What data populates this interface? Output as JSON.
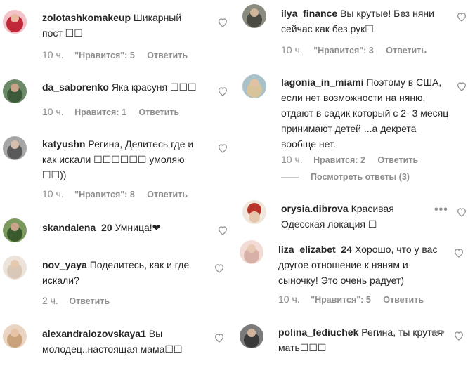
{
  "left": [
    {
      "username": "zolotashkomakeup",
      "text": "Шикарный пост ☐☐",
      "time": "10 ч.",
      "likes": "\"Нравится\": 5",
      "reply": "Ответить",
      "avatar_color": "#c0283a"
    },
    {
      "username": "da_saborenko",
      "text": "Яка красуня ☐☐☐",
      "time": "10 ч.",
      "likes": "Нравится: 1",
      "reply": "Ответить",
      "avatar_color": "#3d5a3a"
    },
    {
      "username": "katyushn",
      "text": "Регина, Делитесь где и как искали ☐☐☐☐☐☐ умоляю ☐☐))",
      "time": "10 ч.",
      "likes": "\"Нравится\": 8",
      "reply": "Ответить",
      "avatar_color": "#5a5a5a"
    },
    {
      "username": "skandalena_20",
      "text": "Умница!❤",
      "avatar_color": "#3b5b2f"
    },
    {
      "username": "nov_yaya",
      "text": "Поделитесь, как и где искали?",
      "time": "2 ч.",
      "reply": "Ответить",
      "avatar_color": "#d9c7b8"
    },
    {
      "username": "alexandralozovskaya1",
      "text": "Вы молодец..настоящая мама☐☐",
      "avatar_color": "#c9a27c"
    }
  ],
  "right": [
    {
      "username": "ilya_finance",
      "text": "Вы крутые! Без няни сейчас как без рук☐",
      "time": "10 ч.",
      "likes": "\"Нравится\": 3",
      "reply": "Ответить",
      "avatar_color": "#4a4a42"
    },
    {
      "username": "lagonia_in_miami",
      "text": "Поэтому в США, если нет возможности на няню, отдают в садик который с 2- 3 месяц принимают детей ...а декрета вообще нет.",
      "time": "10 ч.",
      "likes": "Нравится: 2",
      "reply": "Ответить",
      "view_replies": "Посмотреть ответы (3)",
      "avatar_color": "#d8c49a"
    },
    {
      "username": "orysia.dibrova",
      "text": "Красивая Одесская локация ☐",
      "avatar_color": "#b8352b"
    },
    {
      "username": "liza_elizabet_24",
      "text": "Хорошо, что у вас другое отношение к няням и сыночку! Это очень радует)",
      "time": "10 ч.",
      "likes": "\"Нравится\": 5",
      "reply": "Ответить",
      "avatar_color": "#d9b0a8"
    },
    {
      "username": "polina_fediuchek",
      "text": "Регина, ты крутая мать☐☐☐",
      "avatar_color": "#3a3a3a"
    }
  ],
  "more_icon": "•••",
  "icons": {
    "heart": "heart-outline-icon",
    "more": "more-horizontal-icon"
  },
  "colors": {
    "text": "#262626",
    "muted": "#8e8e8e",
    "border": "#c7c7c7"
  }
}
